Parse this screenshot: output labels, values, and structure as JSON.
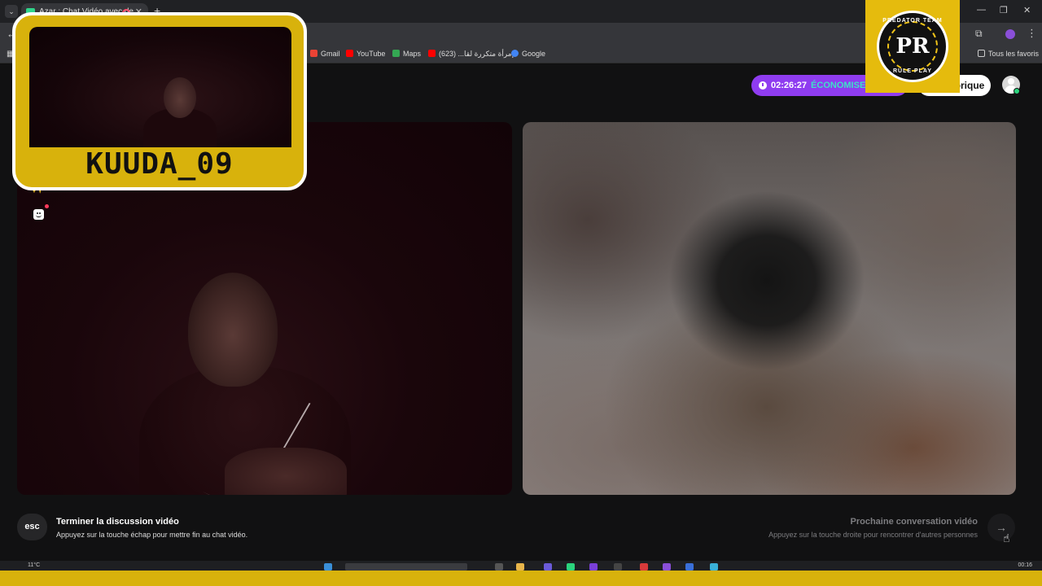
{
  "browser": {
    "tab_title": "Azar : Chat Vidéo avec de...",
    "tab_close": "✕",
    "new_tab": "+",
    "tablist_icon": "chevron-down-icon",
    "window_controls": [
      "—",
      "❐",
      "✕"
    ],
    "bookmarks": [
      {
        "label": "Gmail",
        "color": "#ea4335"
      },
      {
        "label": "YouTube",
        "color": "#ff0000"
      },
      {
        "label": "Maps",
        "color": "#34a853"
      },
      {
        "label": "إمرأة متكررة لقا... (623)",
        "color": "#ff0000"
      },
      {
        "label": "Google",
        "color": "#4285f4"
      }
    ],
    "all_bookmarks": "Tous les favoris"
  },
  "header": {
    "timer": "02:26:27",
    "promo": "ÉCONOMISE T",
    "history_label": "Historique",
    "accent": "#8f3cf0",
    "promo_color": "#3fe0c8"
  },
  "controls": {
    "effects_icon": "magic-wand-icon",
    "sticker_icon": "sticker-face-icon"
  },
  "footer": {
    "esc_label": "esc",
    "end_title": "Terminer la discussion vidéo",
    "end_hint": "Appuyez sur la touche échap pour mettre fin au chat vidéo.",
    "next_title": "Prochaine conversation vidéo",
    "next_hint": "Appuyez sur la touche droite pour rencontrer d'autres personnes",
    "next_icon": "arrow-right-icon"
  },
  "taskbar": {
    "weather": "11°C",
    "time": "00:16"
  },
  "overlay": {
    "streamer_name": "KUUDA_09",
    "brand_text_top": "PREDATOR TEAM",
    "brand_monogram": "PR",
    "brand_text_bottom": "RULE PLAY",
    "frame_color": "#d8b20c"
  }
}
